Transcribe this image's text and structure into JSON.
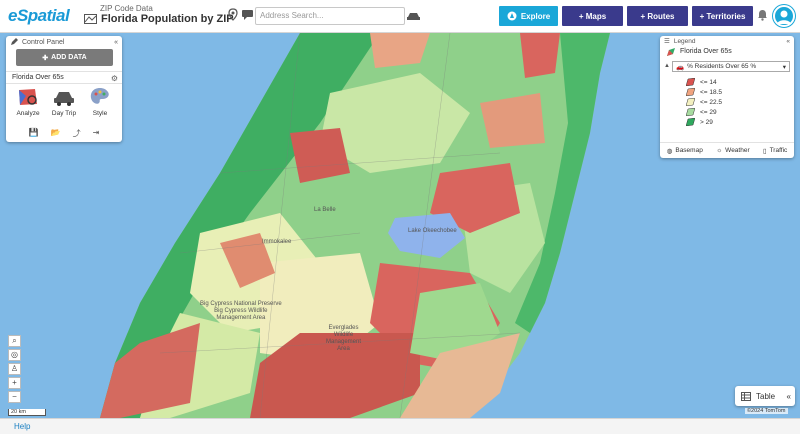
{
  "app": {
    "logo_text": "eSpatial"
  },
  "map_header": {
    "subtitle": "ZIP Code Data",
    "title": "Florida Population by ZIP"
  },
  "search": {
    "placeholder": "Address Search..."
  },
  "nav": {
    "explore": "Explore",
    "maps": "+ Maps",
    "routes": "+ Routes",
    "territories": "+ Territories"
  },
  "control_panel": {
    "title": "Control Panel",
    "collapse": "«",
    "add_data": "ADD DATA",
    "layer_name": "Florida Over 65s",
    "tools": [
      {
        "label": "Analyze",
        "icon": "analyze-icon"
      },
      {
        "label": "Day Trip",
        "icon": "car-icon"
      },
      {
        "label": "Style",
        "icon": "palette-icon"
      }
    ]
  },
  "legend": {
    "title": "Legend",
    "collapse": "«",
    "layer_name": "Florida Over 65s",
    "selected_field": "% Residents Over 65 %",
    "items": [
      {
        "label": "<= 14",
        "color": "#d9534f"
      },
      {
        "label": "<= 18.5",
        "color": "#f0a37f"
      },
      {
        "label": "<= 22.5",
        "color": "#f3f0c0"
      },
      {
        "label": "<= 29",
        "color": "#a7dba0"
      },
      {
        "label": "> 29",
        "color": "#2fa85e"
      }
    ],
    "footer": {
      "basemap": "Basemap",
      "weather": "Weather",
      "traffic": "Traffic"
    }
  },
  "map_labels": {
    "la_belle": "La Belle",
    "lake_okeechobee": "Lake Okeechobee",
    "big_cypress": "Big Cypress National Preserve\nBig Cypress Wildlife\nManagement Area",
    "everglades": "Everglades\nWildlife\nManagement\nArea",
    "immokalee": "Immokalee"
  },
  "scale": {
    "label": "20 km"
  },
  "table_button": {
    "label": "Table",
    "collapse": "«"
  },
  "copyright": "©2024 TomTom",
  "help": "Help",
  "colors": {
    "accent": "#1aa7d8",
    "nav_dark": "#3a3a8c"
  }
}
